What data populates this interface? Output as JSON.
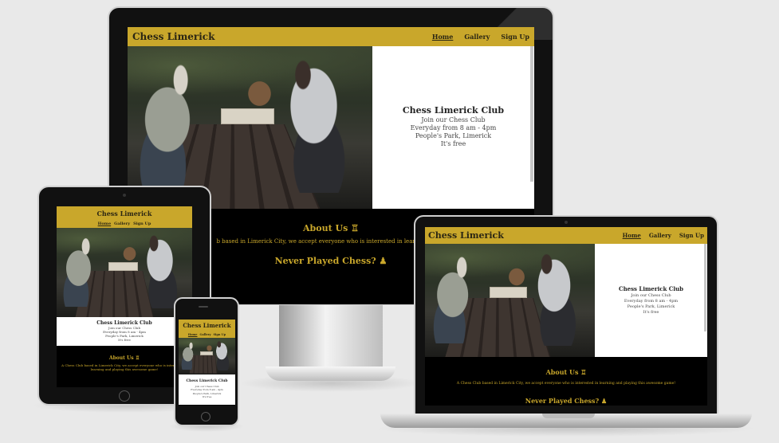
{
  "site": {
    "brand": "Chess Limerick",
    "nav": [
      {
        "label": "Home",
        "active": true
      },
      {
        "label": "Gallery",
        "active": false
      },
      {
        "label": "Sign Up",
        "active": false
      }
    ],
    "hero": {
      "title": "Chess Limerick Club",
      "line1": "Join our Chess Club",
      "line2": "Everyday from 8 am - 4pm",
      "line3": "People's Park, Limerick",
      "line4": "It's free"
    },
    "about": {
      "heading": "About Us ♖",
      "text": "A Chess Club based in Limerick City, we accept everyone who is interested in learning and playing this awesome game!",
      "text_monitor": "b based in Limerick City, we accept everyone who is interested in learning and p"
    },
    "never": {
      "heading": "Never Played Chess? ♟"
    }
  },
  "colors": {
    "gold": "#c9a72b",
    "dark_text": "#2b2613",
    "background": "#e9e9e9",
    "bezel": "#111111"
  },
  "icons": {
    "about": "rook-icon",
    "never": "pawn-icon"
  }
}
